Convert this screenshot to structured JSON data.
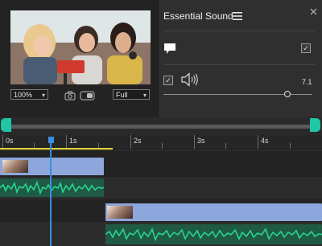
{
  "preview": {
    "zoom": "100%",
    "quality": "Full"
  },
  "essential_sound": {
    "title": "Essential Sound",
    "volume_value": "7.1",
    "volume_level": 0.83
  },
  "timeline": {
    "ticks": [
      "0s",
      "1s",
      "2s",
      "3s",
      "4s"
    ]
  },
  "colors": {
    "accent_teal": "#1fc7a4",
    "playhead": "#3b8ee0",
    "video_clip": "#8da6dc",
    "audio_clip": "#1f5a44",
    "waveform": "#29d394",
    "work_area": "#e7d63a"
  },
  "icons": [
    "menu-icon",
    "close-icon",
    "speech-bubble-icon",
    "speaker-icon",
    "camera-icon",
    "toggle-icon",
    "playhead-icon"
  ]
}
